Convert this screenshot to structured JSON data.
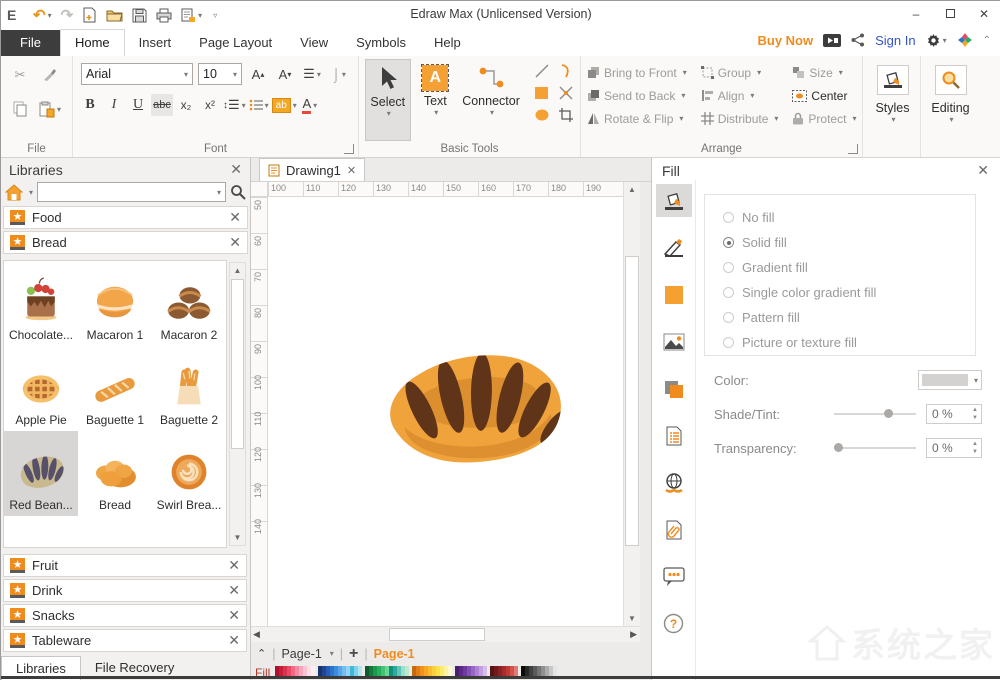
{
  "titlebar": {
    "title": "Edraw Max (Unlicensed Version)"
  },
  "tabs": {
    "file": "File",
    "home": "Home",
    "insert": "Insert",
    "page_layout": "Page Layout",
    "view": "View",
    "symbols": "Symbols",
    "help": "Help"
  },
  "tabrow_right": {
    "buy_now": "Buy Now",
    "sign_in": "Sign In"
  },
  "ribbon": {
    "file_group": {
      "label": "File"
    },
    "font_group": {
      "label": "Font",
      "family": "Arial",
      "size": "10",
      "bold": "B",
      "italic": "I",
      "underline": "U",
      "strike": "abc",
      "sub": "x₂",
      "sup": "x²",
      "color_a": "A"
    },
    "basic_group": {
      "label": "Basic Tools",
      "select": "Select",
      "text": "Text",
      "connector": "Connector",
      "text_icon": "A"
    },
    "arrange_group": {
      "label": "Arrange",
      "items": [
        "Bring to Front",
        "Send to Back",
        "Rotate & Flip",
        "Group",
        "Align",
        "Distribute",
        "Size",
        "Center",
        "Protect"
      ]
    },
    "styles": "Styles",
    "editing": "Editing"
  },
  "libraries": {
    "title": "Libraries",
    "section_food": "Food",
    "section_bread": "Bread",
    "items": [
      {
        "label": "Chocolate...",
        "icon": "chocolate-cake",
        "selected": false
      },
      {
        "label": "Macaron 1",
        "icon": "macaron-1",
        "selected": false
      },
      {
        "label": "Macaron 2",
        "icon": "macaron-2",
        "selected": false
      },
      {
        "label": "Apple Pie",
        "icon": "apple-pie",
        "selected": false
      },
      {
        "label": "Baguette 1",
        "icon": "baguette-1",
        "selected": false
      },
      {
        "label": "Baguette 2",
        "icon": "baguette-2",
        "selected": false
      },
      {
        "label": "Red Bean...",
        "icon": "red-bean-bread",
        "selected": true
      },
      {
        "label": "Bread",
        "icon": "bread",
        "selected": false
      },
      {
        "label": "Swirl Brea...",
        "icon": "swirl-bread",
        "selected": false
      },
      {
        "label": "",
        "icon": "bread-round-1",
        "selected": false
      },
      {
        "label": "",
        "icon": "bread-round-2",
        "selected": false
      },
      {
        "label": "",
        "icon": "bread-round-3",
        "selected": false
      }
    ],
    "sections_bottom": [
      "Fruit",
      "Drink",
      "Snacks",
      "Tableware"
    ],
    "tabs_bottom": [
      "Libraries",
      "File Recovery"
    ]
  },
  "canvas": {
    "doc_tab": "Drawing1",
    "h_ruler": [
      100,
      110,
      120,
      130,
      140,
      150,
      160,
      170,
      180,
      190
    ],
    "v_ruler": [
      50,
      60,
      70,
      80,
      90,
      100,
      110,
      120,
      130,
      140
    ],
    "page_selector": "Page-1",
    "add_page": "+",
    "page_tab": "Page-1",
    "fill_label": "Fill"
  },
  "fill_panel": {
    "title": "Fill",
    "options": [
      "No fill",
      "Solid fill",
      "Gradient fill",
      "Single color gradient fill",
      "Pattern fill",
      "Picture or texture fill"
    ],
    "selected": "Solid fill",
    "color_label": "Color:",
    "shade_label": "Shade/Tint:",
    "shade_value": "0 %",
    "transparency_label": "Transparency:",
    "transparency_value": "0 %"
  },
  "watermark": "系统之家",
  "accent_color": "#F08C1E",
  "palette": [
    [
      "#B01030",
      "#C41E3A",
      "#D93250",
      "#E84A66",
      "#EF6A84",
      "#F28AA2",
      "#F5A8BC",
      "#F8C4D2",
      "#FADDE6",
      "#FCEEF3"
    ],
    [
      "#16346E",
      "#1F4692",
      "#2A5BB4",
      "#2E74C9",
      "#3C8EDC",
      "#56A5E8",
      "#74BCEF",
      "#97CFF5",
      "#3FB8DC",
      "#7DD3EA",
      "#B2E5F3"
    ],
    [
      "#0E5A2E",
      "#147A3C",
      "#1C9A4C",
      "#27AE60",
      "#44C273",
      "#6ED48E",
      "#0F8F80",
      "#2FA898",
      "#62C4B6",
      "#9ADFD2",
      "#BFEAC8"
    ],
    [
      "#C66A10",
      "#E07E16",
      "#F0921C",
      "#F6A623",
      "#F9BC30",
      "#FBD03C",
      "#FDE14A",
      "#FDEB6E",
      "#FEF3A0",
      "#FEF9CF"
    ],
    [
      "#4A1E6E",
      "#5C2A86",
      "#6F3A9E",
      "#8350B4",
      "#9866C4",
      "#AD82D2",
      "#C29FE0",
      "#D8BCEC"
    ],
    [
      "#5A1414",
      "#701C1C",
      "#8A2424",
      "#A42C2C",
      "#BE3A34",
      "#D4524A",
      "#E07A72"
    ],
    [
      "#0A0A0A",
      "#262626",
      "#404040",
      "#5A5A5A",
      "#747474",
      "#909090",
      "#ACACAC",
      "#C8C8C8",
      "#E4E4E4"
    ]
  ]
}
